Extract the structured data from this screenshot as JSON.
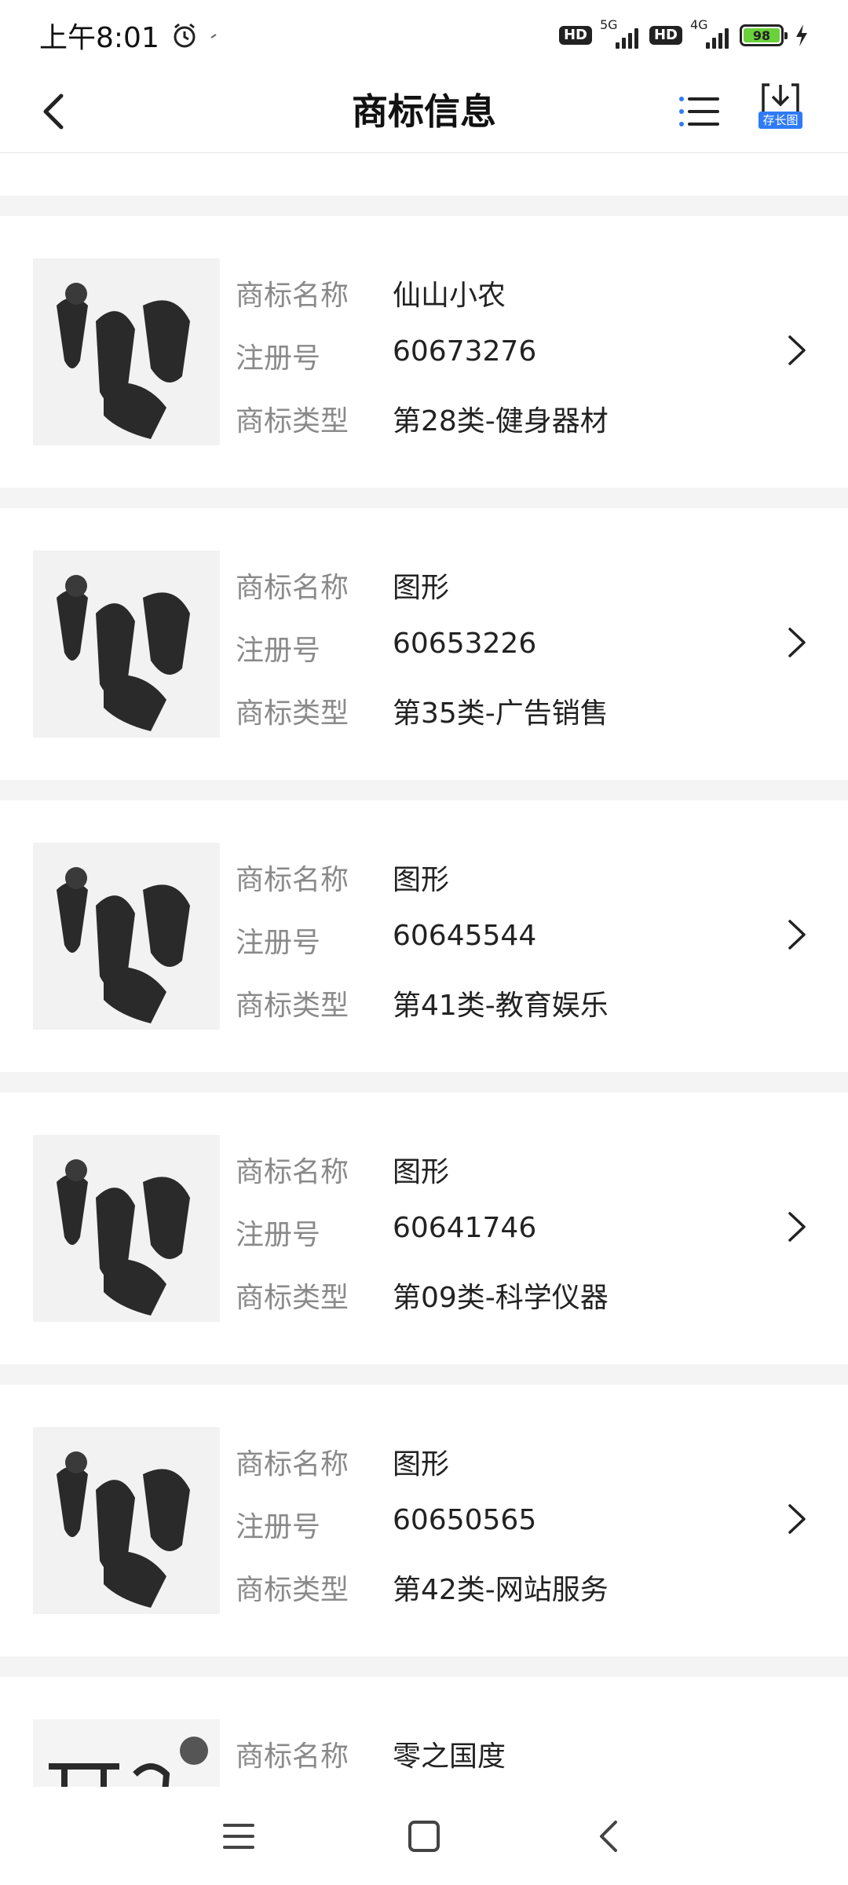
{
  "status_bar": {
    "time": "上午8:01",
    "net1": "5G",
    "net2": "4G",
    "hd1": "HD",
    "hd2": "HD",
    "battery": "98"
  },
  "header": {
    "title": "商标信息",
    "save_label": "存长图"
  },
  "labels": {
    "name": "商标名称",
    "reg_no": "注册号",
    "type": "商标类型"
  },
  "trademarks": [
    {
      "name": "仙山小农",
      "reg_no": "60673276",
      "type": "第28类-健身器材"
    },
    {
      "name": "图形",
      "reg_no": "60653226",
      "type": "第35类-广告销售"
    },
    {
      "name": "图形",
      "reg_no": "60645544",
      "type": "第41类-教育娱乐"
    },
    {
      "name": "图形",
      "reg_no": "60641746",
      "type": "第09类-科学仪器"
    },
    {
      "name": "图形",
      "reg_no": "60650565",
      "type": "第42类-网站服务"
    },
    {
      "name": "零之国度",
      "reg_no": "",
      "type": ""
    }
  ],
  "icons": {
    "back": "back-arrow-icon",
    "list": "list-icon",
    "save": "download-icon",
    "chevron": "chevron-right-icon"
  },
  "colors": {
    "accent": "#2f7bf5",
    "battery": "#6ad13a",
    "label": "#8a8a8a",
    "separator": "#f4f4f4"
  }
}
